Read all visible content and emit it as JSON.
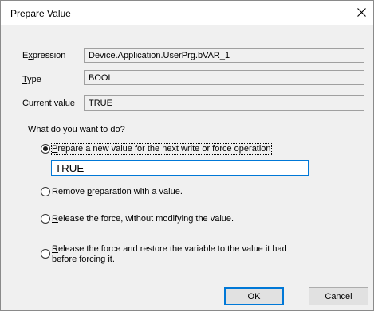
{
  "window": {
    "title": "Prepare Value",
    "close_icon": "close-icon"
  },
  "fields": {
    "expression": {
      "label_first": "E",
      "label_underline": "x",
      "label_rest": "pression",
      "value": "Device.Application.UserPrg.bVAR_1"
    },
    "type": {
      "label_underline": "T",
      "label_rest": "ype",
      "value": "BOOL"
    },
    "current": {
      "label_underline": "C",
      "label_rest": "urrent value",
      "value": "TRUE"
    }
  },
  "question": "What do you want to do?",
  "options": [
    {
      "pre": "",
      "underline": "P",
      "post": "repare a new value for the next write or force operation",
      "checked": true
    },
    {
      "pre": "Remove ",
      "underline": "p",
      "post": "reparation with a value.",
      "checked": false
    },
    {
      "pre": "",
      "underline": "R",
      "post": "elease the force, without modifying the value.",
      "checked": false
    },
    {
      "pre": "",
      "underline": "R",
      "post": "elease the force and restore the variable to the value it had",
      "line2": "before forcing it.",
      "checked": false
    }
  ],
  "new_value": "TRUE",
  "buttons": {
    "ok": "OK",
    "cancel": "Cancel"
  }
}
